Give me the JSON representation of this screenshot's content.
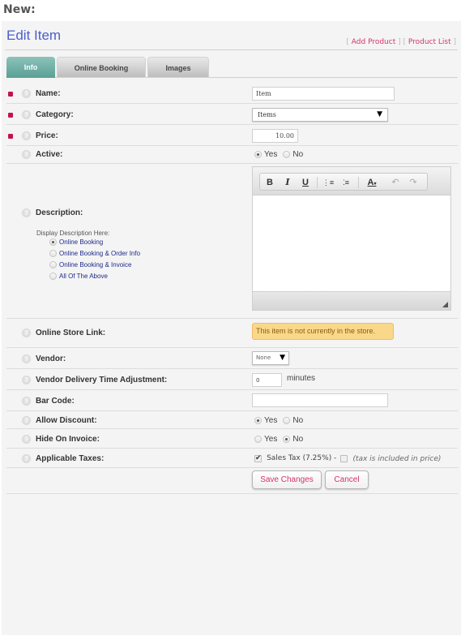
{
  "screen_label": "New:",
  "header": {
    "title": "Edit Item",
    "links": [
      {
        "label": "Add Product"
      },
      {
        "label": "Product List"
      }
    ]
  },
  "tabs": [
    {
      "label": "Info",
      "active": true
    },
    {
      "label": "Online Booking",
      "active": false
    },
    {
      "label": "Images",
      "active": false
    }
  ],
  "colors": {
    "accent": "#4a5fc9",
    "link": "#d4346c",
    "required": "#c3134a",
    "tab_active": "#6aa9a0",
    "notice_bg": "#fad88a"
  },
  "form": {
    "name": {
      "label": "Name:",
      "value": "Item",
      "required": true
    },
    "category": {
      "label": "Category:",
      "value": "Items",
      "required": true
    },
    "price": {
      "label": "Price:",
      "value": "10.00",
      "required": true
    },
    "active": {
      "label": "Active:",
      "options": [
        "Yes",
        "No"
      ],
      "selected": "Yes"
    },
    "description": {
      "label": "Description:",
      "display_label": "Display Description Here:",
      "display_options": [
        "Online Booking",
        "Online Booking & Order Info",
        "Online Booking & Invoice",
        "All Of The Above"
      ],
      "display_selected": "Online Booking",
      "toolbar": {
        "bold": "B",
        "italic": "I",
        "underline": "U",
        "ordered_list": "⋮≡",
        "unordered_list": "⁚≡",
        "font_color": "A",
        "undo": "↶",
        "redo": "↷"
      },
      "value": ""
    },
    "online_store_link": {
      "label": "Online Store Link:",
      "notice": "This item is not currently in the store."
    },
    "vendor": {
      "label": "Vendor:",
      "value": "None"
    },
    "vendor_delivery": {
      "label": "Vendor Delivery Time Adjustment:",
      "value": "0",
      "unit": "minutes"
    },
    "bar_code": {
      "label": "Bar Code:",
      "value": ""
    },
    "allow_discount": {
      "label": "Allow Discount:",
      "options": [
        "Yes",
        "No"
      ],
      "selected": "Yes"
    },
    "hide_on_invoice": {
      "label": "Hide On Invoice:",
      "options": [
        "Yes",
        "No"
      ],
      "selected": "No"
    },
    "applicable_taxes": {
      "label": "Applicable Taxes:",
      "tax_name": "Sales Tax (7.25%) -",
      "tax_checked": true,
      "included_checked": false,
      "included_note": "(tax is included in price)"
    }
  },
  "actions": {
    "save_label": "Save Changes",
    "cancel_label": "Cancel"
  }
}
